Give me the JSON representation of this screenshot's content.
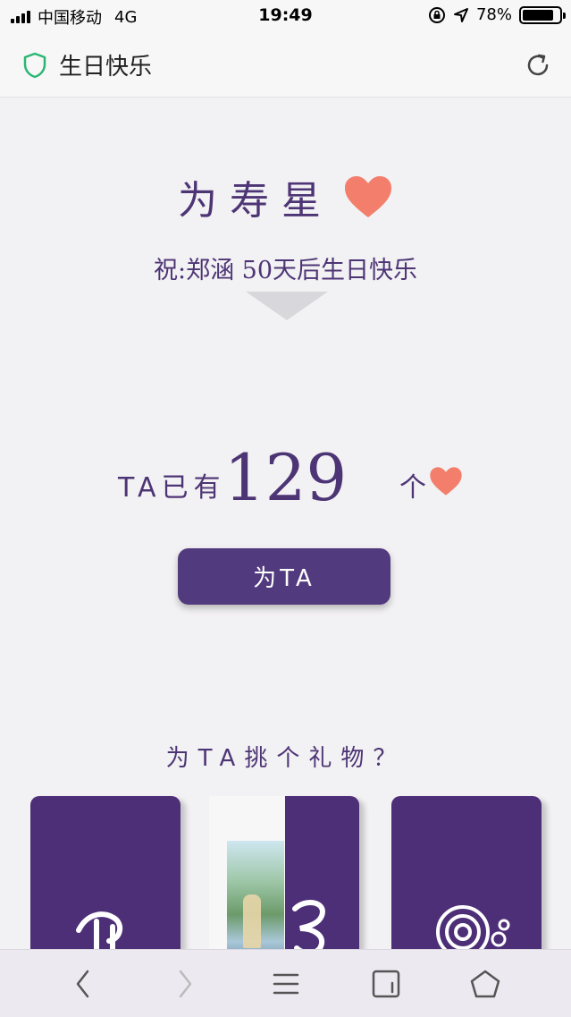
{
  "status_bar": {
    "carrier": "中国移动",
    "network": "4G",
    "time": "19:49",
    "battery": "78%",
    "battery_level": 0.78
  },
  "title_bar": {
    "title": "生日快乐",
    "shield_icon": "shield-icon",
    "reload_icon": "reload-icon"
  },
  "main": {
    "heading": "为寿星",
    "heading_icon": "heart-icon",
    "subtitle": "祝:郑涵 50天后生日快乐",
    "count_label": "TA已有",
    "count_value": "129",
    "count_unit": "个",
    "send_button": "为TA"
  },
  "gifts": {
    "question": "为TA挑个礼物？",
    "cards": [
      {
        "icon": "cake-icon"
      },
      {
        "icon": "photo-icon"
      },
      {
        "icon": "camera-icon"
      }
    ]
  },
  "toolbar": {
    "items": [
      "back-icon",
      "forward-icon",
      "menu-icon",
      "tabs-icon",
      "home-icon"
    ]
  },
  "colors": {
    "accent": "#523a7e",
    "heart": "#f37e6b",
    "background": "#f2f1f3"
  }
}
